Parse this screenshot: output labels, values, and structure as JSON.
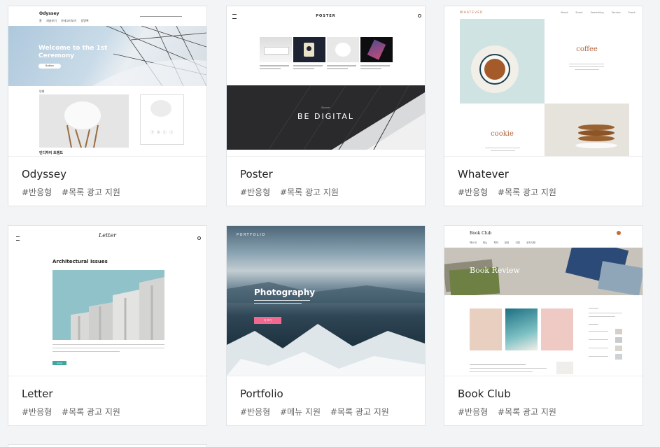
{
  "cards": [
    {
      "name": "Odyssey",
      "tags": [
        "#반응형",
        "#목록 광고 지원"
      ],
      "preview": {
        "logo": "Odyssey",
        "nav": [
          "홈",
          "새글보기",
          "카테고리보기",
          "방명록"
        ],
        "hero_title_line1": "Welcome to the 1st",
        "hero_title_line2": "Ceremony",
        "hero_button": "Button",
        "section_label": "인테",
        "caption": "인디자이 트렌드"
      }
    },
    {
      "name": "Poster",
      "tags": [
        "#반응형",
        "#목록 광고 지원"
      ],
      "preview": {
        "logo": "POSTER",
        "banner_small": "Banner",
        "banner_text": "BE DIGITAL"
      }
    },
    {
      "name": "Whatever",
      "tags": [
        "#반응형",
        "#목록 광고 지원"
      ],
      "preview": {
        "logo": "WHATEVER",
        "nav": [
          "About",
          "Event",
          "Something",
          "Service",
          "Event"
        ],
        "coffee": "coffee",
        "cookie": "cookie"
      }
    },
    {
      "name": "Letter",
      "tags": [
        "#반응형",
        "#목록 광고 지원"
      ],
      "preview": {
        "logo": "Letter",
        "post_title": "Architectural Issues",
        "button": "more"
      }
    },
    {
      "name": "Portfolio",
      "tags": [
        "#반응형",
        "#메뉴 지원",
        "#목록 광고 지원"
      ],
      "preview": {
        "logo": "PORTFOLIO",
        "hero_title": "Photography",
        "button": "더 보기"
      }
    },
    {
      "name": "Book Club",
      "tags": [
        "#반응형",
        "#목록 광고 지원"
      ],
      "preview": {
        "logo": "Book Club",
        "nav": [
          "책소개",
          "메뉴",
          "책의 완성",
          "리뷰",
          "공지사항"
        ],
        "banner": "Book Review"
      }
    }
  ]
}
